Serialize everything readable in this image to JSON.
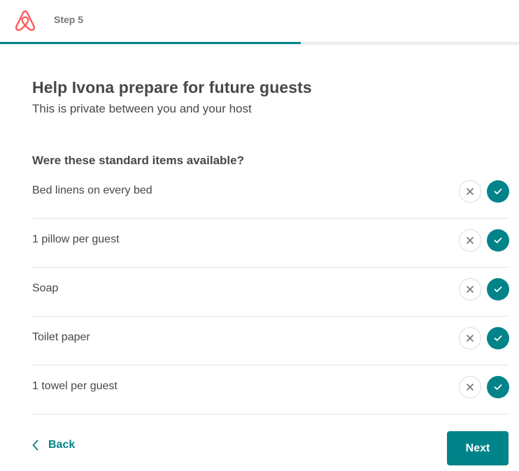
{
  "header": {
    "logo_icon": "airbnb-logo-icon",
    "step_label": "Step 5",
    "progress_fraction": 0.58
  },
  "main": {
    "title": "Help Ivona prepare for future guests",
    "subtitle": "This is private between you and your host",
    "question": "Were these standard items available?",
    "items": [
      {
        "label": "Bed linens on every bed",
        "answer": "yes"
      },
      {
        "label": "1 pillow per guest",
        "answer": "yes"
      },
      {
        "label": "Soap",
        "answer": "yes"
      },
      {
        "label": "Toilet paper",
        "answer": "yes"
      },
      {
        "label": "1 towel per guest",
        "answer": "yes"
      }
    ]
  },
  "footer": {
    "back_label": "Back",
    "next_label": "Next"
  },
  "colors": {
    "accent": "#008489",
    "brand": "#FF5A5F",
    "text": "#484848",
    "muted": "#767676"
  }
}
